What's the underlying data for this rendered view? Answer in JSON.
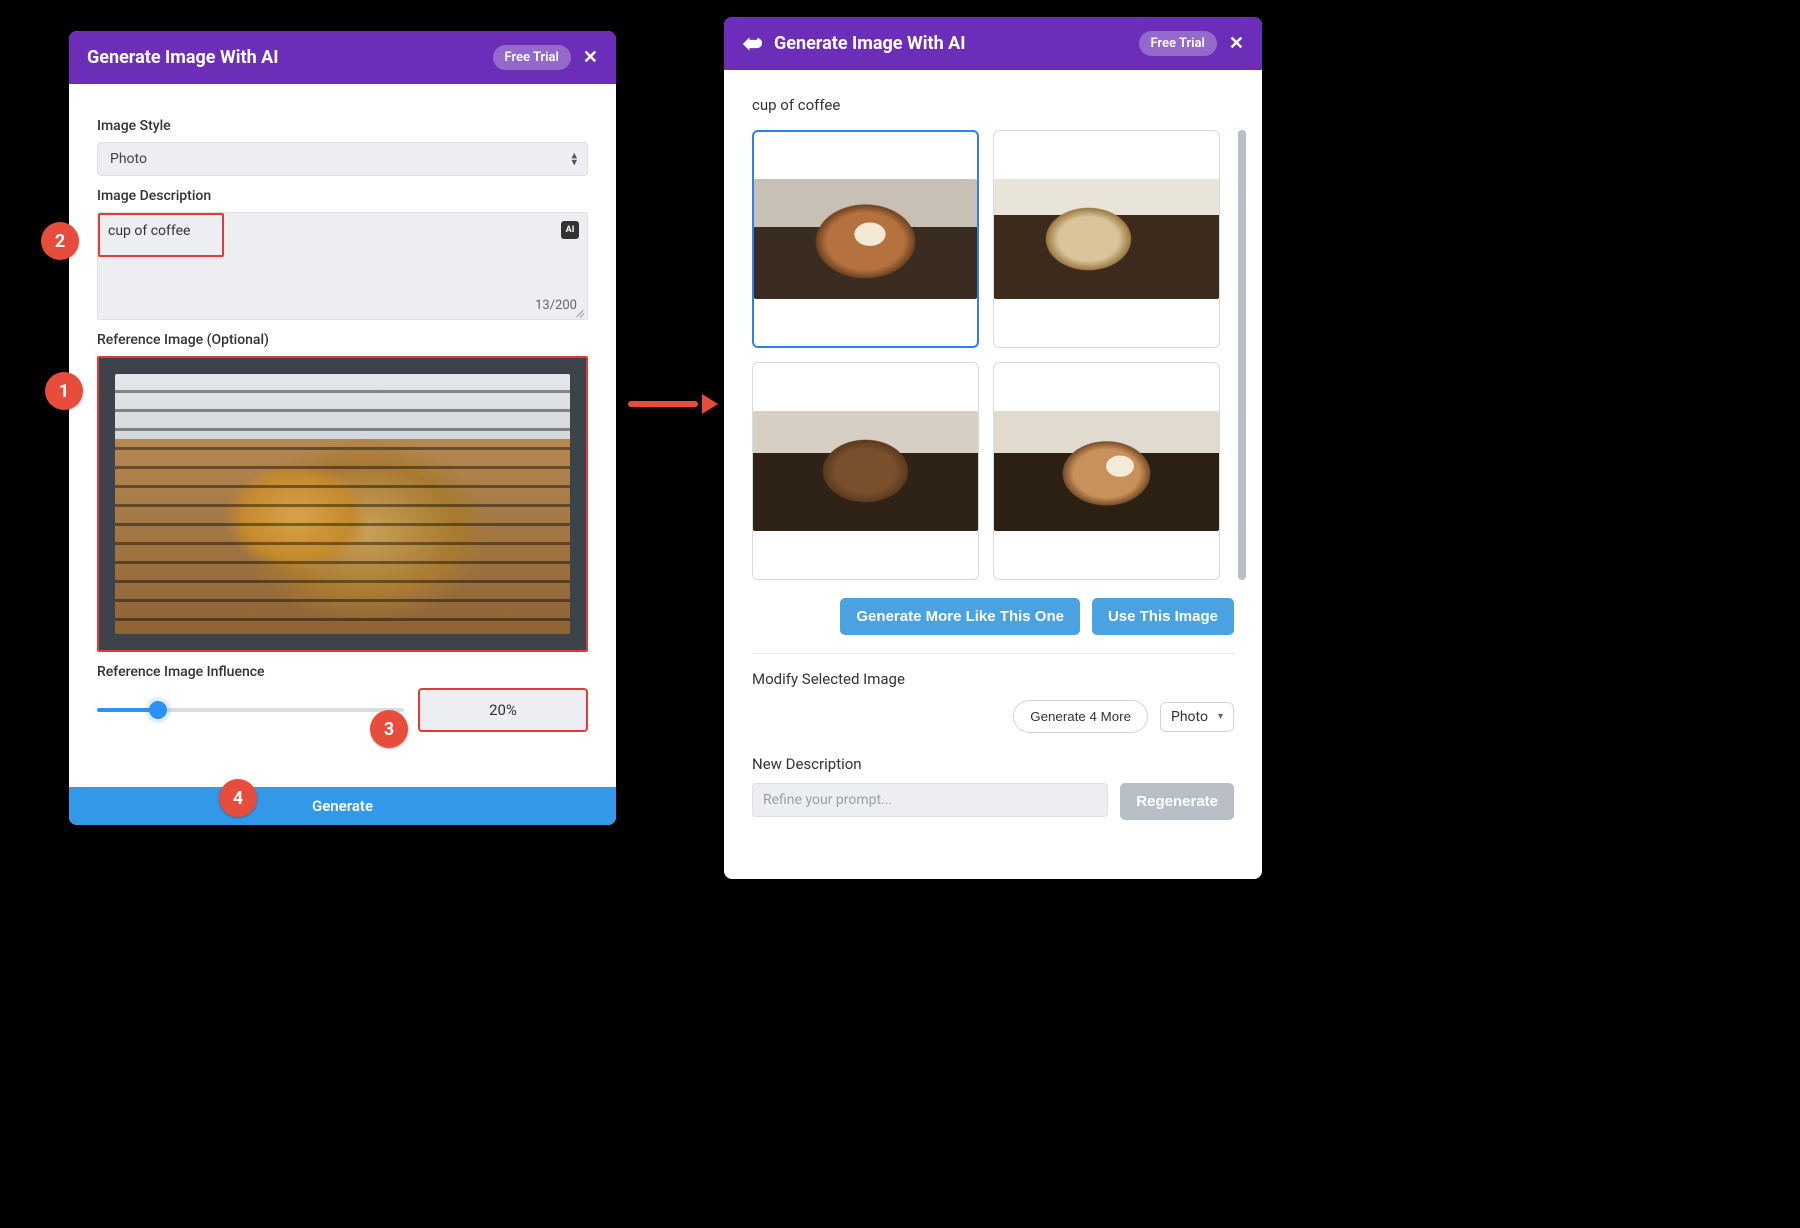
{
  "left": {
    "title": "Generate Image With AI",
    "free_trial": "Free Trial",
    "close": "✕",
    "style_label": "Image Style",
    "style_value": "Photo",
    "desc_label": "Image Description",
    "desc_value": "cup of coffee",
    "desc_counter": "13/200",
    "ai_badge": "AI",
    "ref_label": "Reference Image (Optional)",
    "influence_label": "Reference Image Influence",
    "influence_value": "20%",
    "generate_btn": "Generate"
  },
  "right": {
    "title": "Generate Image With AI",
    "free_trial": "Free Trial",
    "close": "✕",
    "prompt_echo": "cup of coffee",
    "btn_more_like": "Generate More Like This One",
    "btn_use": "Use This Image",
    "modify_label": "Modify Selected Image",
    "btn_gen4": "Generate 4 More",
    "style_value": "Photo",
    "new_desc_label": "New Description",
    "refine_placeholder": "Refine your prompt...",
    "regenerate_btn": "Regenerate"
  },
  "callouts": {
    "c1": "1",
    "c2": "2",
    "c3": "3",
    "c4": "4"
  }
}
